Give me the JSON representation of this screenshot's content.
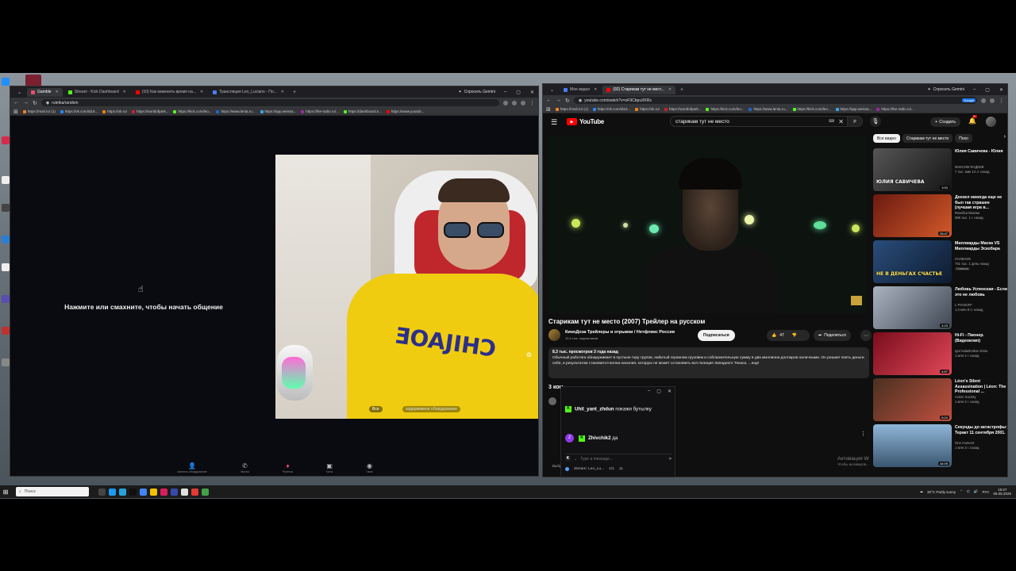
{
  "left_window": {
    "tabs": [
      {
        "label": "Gamble",
        "color": "#e94f6a",
        "active": true
      },
      {
        "label": "Stream - Kick Dashboard",
        "color": "#53fc18",
        "active": false
      },
      {
        "label": "(10) Как изменить время на...",
        "color": "#ff0000",
        "active": false
      },
      {
        "label": "Трансляция Leo_Luciano - По...",
        "color": "#4a7cff",
        "active": false
      }
    ],
    "gemini_label": "Спросить Gemini",
    "url": "ruletka/random",
    "bookmarks": [
      "https://mail.ru/ (1)",
      "https://vk.com/id10...",
      "https://ok.ru/",
      "https://worldofpark...",
      "https://kick.com/leo...",
      "https://www.lenta.ru...",
      "https://app.weissa...",
      "https://the-radio.ru/...",
      "https://dashboard.s...",
      "https://www.youtub..."
    ],
    "prompt": "Нажмите или смахните, чтобы начать общение",
    "cam_badge": "Все",
    "cam_badge2": "задерживное оборудование",
    "shirt_text": "ƎOAJIHƆ",
    "bottom_nav": [
      {
        "label": "сменить оборудование",
        "icon": "👤"
      },
      {
        "label": "Звонок",
        "icon": "✆"
      },
      {
        "label": "Рулетка",
        "icon": "♦"
      },
      {
        "label": "Чаты",
        "icon": "▣"
      },
      {
        "label": "Чаты",
        "icon": "◉"
      }
    ]
  },
  "right_window": {
    "tabs": [
      {
        "label": "Мое видео",
        "color": "#4a7cff",
        "active": false
      },
      {
        "label": "(92) Старикам тут не мест...",
        "color": "#ff0000",
        "active": true
      }
    ],
    "gemini_label": "Спросить Gemini",
    "url": "youtube.com/watch?v=oF9CbpuXKRs",
    "google_badge": "Google",
    "bookmarks": [
      "https://mail.ru/ (1)",
      "https://vk.com/id10...",
      "https://ok.ru/",
      "https://worldofpark...",
      "https://kick.com/leo...",
      "https://www.lenta.ru...",
      "https://kick.com/leo...",
      "https://app.weissa...",
      "https://the-radio.ru/..."
    ]
  },
  "youtube": {
    "logo": "YouTube",
    "search_query": "старикам тут не место",
    "create_label": "Создать",
    "notifications_count": "9+",
    "video_title": "Старикам тут не место (2007) Трейлер на русском",
    "channel_name": "КиноДоза Трейлеры и отрывки / Нетфликс Россия",
    "subscribers": "10,4 тыс. подписчиков",
    "subscribe_label": "Подписаться",
    "likes": "47",
    "share_label": "Поделиться",
    "stats": "8,3 тыс. просмотров  3 года назад",
    "description": "Обычный работяга обнаруживает в пустыне гору трупов, набитый героином грузовик и соблазнительную сумму в два миллиона долларов наличными. Он решает взять деньги себе, и результатом становится волна насилия, которую не может остановить вся полиция Западного Техаса. ...ещё",
    "comments_heading": "3 ком",
    "comments_footer": "Выбр...                                                                 казаны избранные комментарии.",
    "activation": "Активация W",
    "activation_small": "Чтобы активиров...",
    "chips": [
      "Все видео",
      "Старикам тут не место",
      "Похо"
    ],
    "recommendations": [
      {
        "title": "Юлия Савичева - Юлия",
        "channel": "МАКСИМ ФАДЕЕВ",
        "meta": "7 тыс. мин  12 л. назад",
        "duration": "3:53",
        "thumb_text": "ЮЛИЯ САВИЧЕВА",
        "thumb_bg": "linear-gradient(135deg,#444,#1a1a1a)"
      },
      {
        "title": "Дензел никогда еще не был так страшен (лучшая игра в...",
        "channel": "Rossfica Вовпки",
        "meta": "986 тыс.  1 г. назад",
        "duration": "28:47",
        "thumb_text": "",
        "thumb_bg": "linear-gradient(135deg,#6b1a10,#d2592a)"
      },
      {
        "title": "Миллиарды Маска VS Миллиарды Эскобара",
        "channel": "ПАЛЕНИК",
        "meta": "751 тыс.  1 день назад",
        "duration": "",
        "badge": "Новинка",
        "thumb_text": "НЕ В ДЕНЬГАХ СЧАСТЬЕ",
        "thumb_bg": "linear-gradient(135deg,#2a4d7a,#0d1b30)"
      },
      {
        "title": "Любовь Успенская - Если это не любовь",
        "channel": "L-PIANOFF",
        "meta": "1,3 млн  8 л. назад",
        "duration": "4:23",
        "thumb_text": "",
        "thumb_bg": "linear-gradient(135deg,#aab4c0,#3e4652)"
      },
      {
        "title": "Hi-Fi - Пионер. (Видеоклип)",
        "channel": "Igor kalashnikov show",
        "meta": "1 млн  2 г. назад",
        "duration": "4:57",
        "thumb_text": "",
        "thumb_bg": "linear-gradient(135deg,#7a0d1c,#e04858)"
      },
      {
        "title": "Léon's Silent Assassination | Léon: The Professional ...",
        "channel": "Action Society",
        "meta": "1 млн  3 г. назад",
        "duration": "6:24",
        "thumb_text": "",
        "thumb_bg": "linear-gradient(135deg,#4a3020,#c05040)"
      },
      {
        "title": "Секунды до катастрофы: Теракт 11 сентября 2001.",
        "channel": "One moment",
        "meta": "1 млн  3 г. назад",
        "duration": "44:09",
        "thumb_text": "",
        "thumb_bg": "linear-gradient(180deg,#8fb6d8,#3a5670)"
      }
    ]
  },
  "chat": {
    "messages": [
      {
        "user": "Uhil_yant_zhdun",
        "text": "покажи бутылку"
      },
      {
        "user": "Zhivchik2",
        "text": "да"
      }
    ],
    "input_placeholder": "Type a message...",
    "bottom": [
      "Stream: Leo_Lu...",
      "1/1",
      "11"
    ]
  },
  "taskbar": {
    "search_placeholder": "Поиск",
    "weather": "30°C  Partly sunny",
    "lang": "РУС",
    "time": "19:27",
    "date": "06.08.2025"
  }
}
